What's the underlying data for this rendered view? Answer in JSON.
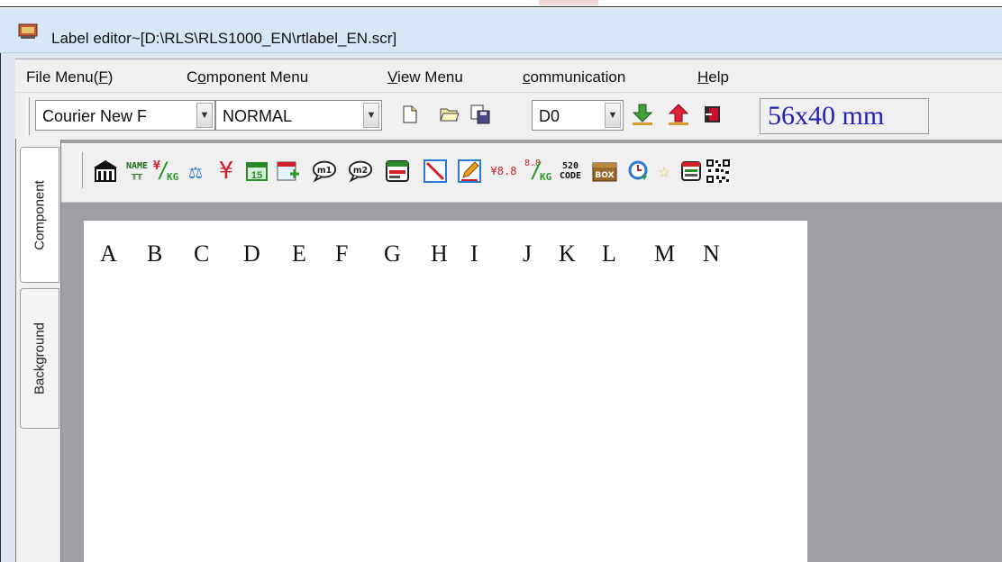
{
  "window": {
    "title": "Label editor~[D:\\RLS\\RLS1000_EN\\rtlabel_EN.scr]"
  },
  "menu": {
    "file": {
      "before": "File Menu(",
      "key": "F",
      "after": ")"
    },
    "component": {
      "before": "C",
      "key": "o",
      "after": "mponent Menu"
    },
    "view": {
      "before": "",
      "key": "V",
      "after": "iew Menu"
    },
    "communication": {
      "before": "",
      "key": "c",
      "after": "ommunication"
    },
    "help": {
      "before": "",
      "key": "H",
      "after": "elp"
    }
  },
  "toolbar": {
    "font_value": "Courier New F",
    "style_value": "NORMAL",
    "device_value": "D0",
    "label_size": "56x40 mm"
  },
  "tabs": {
    "component": "Component",
    "background": "Background"
  },
  "component_buttons": {
    "weight": "¥8.8",
    "unit_price_kg": "8.8",
    "code_top": "520",
    "code_bottom": "CODE",
    "box": "BOX",
    "name": "NAME",
    "yen_kg": "¥",
    "kg": "KG",
    "day": "15",
    "m1": "m1",
    "m2": "m2"
  },
  "canvas": {
    "letters": [
      "A",
      "B",
      "C",
      "D",
      "E",
      "F",
      "G",
      "H",
      "I",
      "J",
      "K",
      "L",
      "M",
      "N"
    ]
  },
  "colors": {
    "title_bg": "#d6e7f7",
    "chrome_bg": "#f0f0f0",
    "workspace_bg": "#a0a0a4",
    "size_text": "#2323b8"
  }
}
